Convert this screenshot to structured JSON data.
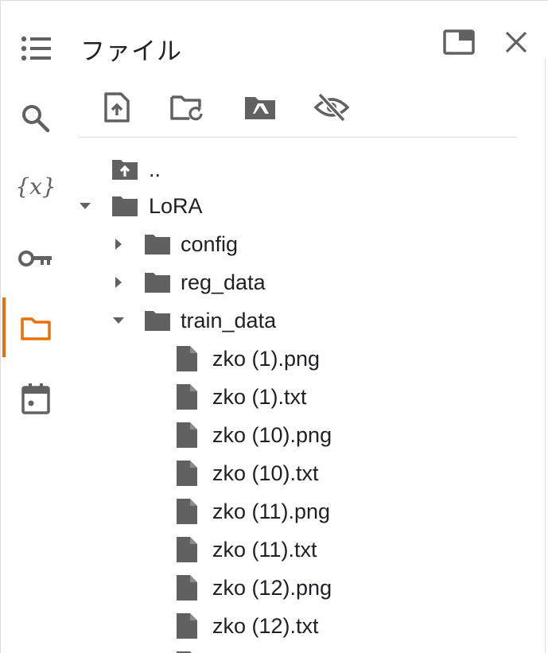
{
  "panel": {
    "title": "ファイル",
    "colors": {
      "accent": "#e8710a",
      "icon": "#616161",
      "text": "#202124"
    }
  },
  "rail": {
    "items": [
      {
        "name": "toc-icon"
      },
      {
        "name": "search-icon"
      },
      {
        "name": "variables-icon"
      },
      {
        "name": "key-icon"
      },
      {
        "name": "folder-icon",
        "active": true
      },
      {
        "name": "calendar-icon"
      }
    ]
  },
  "header": {
    "buttons": [
      {
        "name": "open-in-tab-icon"
      },
      {
        "name": "close-icon"
      }
    ]
  },
  "toolbar": {
    "buttons": [
      {
        "name": "upload-file-icon"
      },
      {
        "name": "refresh-folder-icon"
      },
      {
        "name": "mount-drive-icon"
      },
      {
        "name": "hide-hidden-files-icon"
      }
    ]
  },
  "tree": {
    "items": [
      {
        "label": "..",
        "kind": "parent"
      },
      {
        "label": "LoRA",
        "kind": "folder",
        "expanded": true
      },
      {
        "label": "config",
        "kind": "folder",
        "expanded": false
      },
      {
        "label": "reg_data",
        "kind": "folder",
        "expanded": false
      },
      {
        "label": "train_data",
        "kind": "folder",
        "expanded": true
      },
      {
        "label": "zko (1).png",
        "kind": "file"
      },
      {
        "label": "zko (1).txt",
        "kind": "file"
      },
      {
        "label": "zko (10).png",
        "kind": "file"
      },
      {
        "label": "zko (10).txt",
        "kind": "file"
      },
      {
        "label": "zko (11).png",
        "kind": "file"
      },
      {
        "label": "zko (11).txt",
        "kind": "file"
      },
      {
        "label": "zko (12).png",
        "kind": "file"
      },
      {
        "label": "zko (12).txt",
        "kind": "file"
      }
    ]
  }
}
